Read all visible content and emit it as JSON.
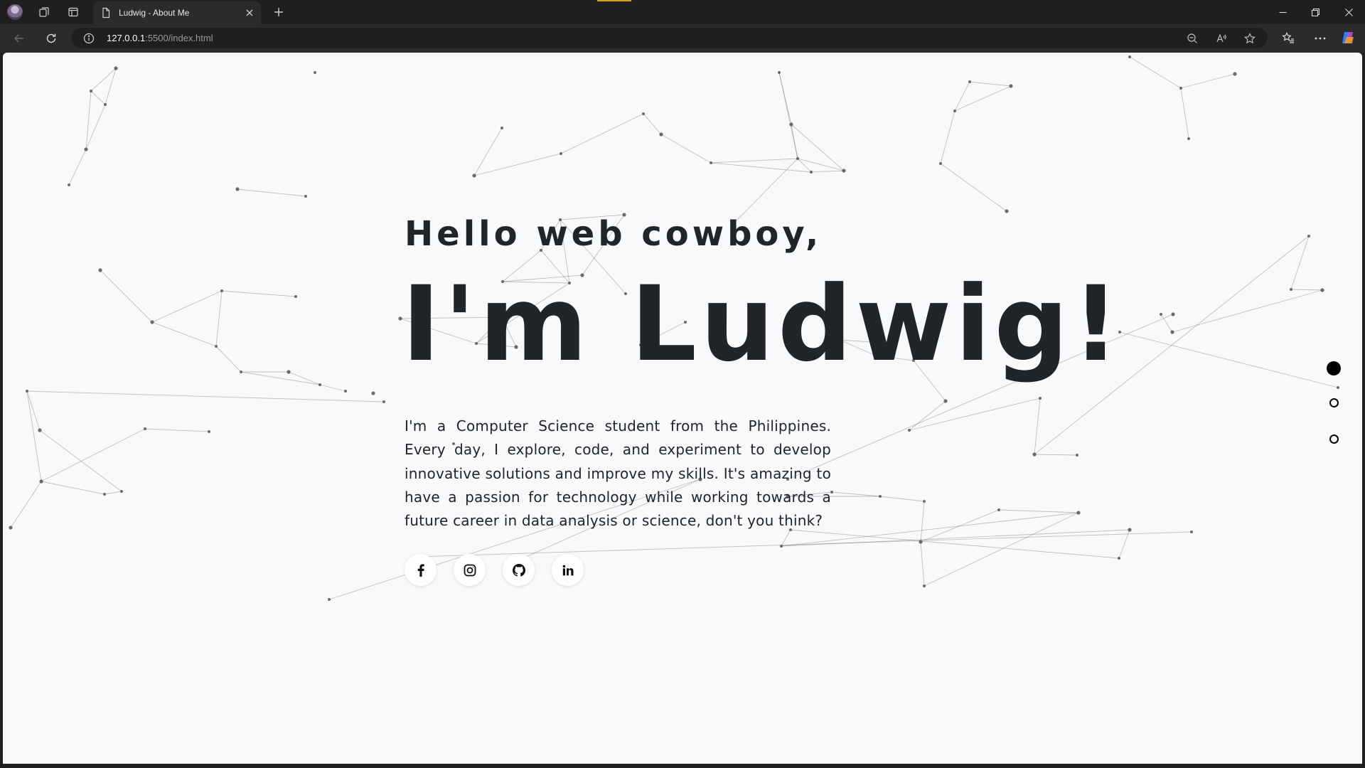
{
  "browser": {
    "tab_title": "Ludwig - About Me",
    "url_host": "127.0.0.1",
    "url_rest": ":5500/index.html"
  },
  "hero": {
    "greeting": "Hello web cowboy,",
    "name": "I'm Ludwig!",
    "bio": "I'm a Computer Science student from the Philippines. Every day, I explore, code, and experiment to develop innovative solutions and improve my skills. It's amazing to have a passion for technology while working towards a future career in data analysis or science, don't you think?"
  },
  "socials": [
    {
      "name": "facebook",
      "icon": "facebook-icon"
    },
    {
      "name": "instagram",
      "icon": "instagram-icon"
    },
    {
      "name": "github",
      "icon": "github-icon"
    },
    {
      "name": "linkedin",
      "icon": "linkedin-icon"
    }
  ],
  "section_nav": {
    "count": 3,
    "active_index": 0
  },
  "colors": {
    "page_background": "#f8f9fa",
    "text": "#212529",
    "particles": "#555555"
  }
}
